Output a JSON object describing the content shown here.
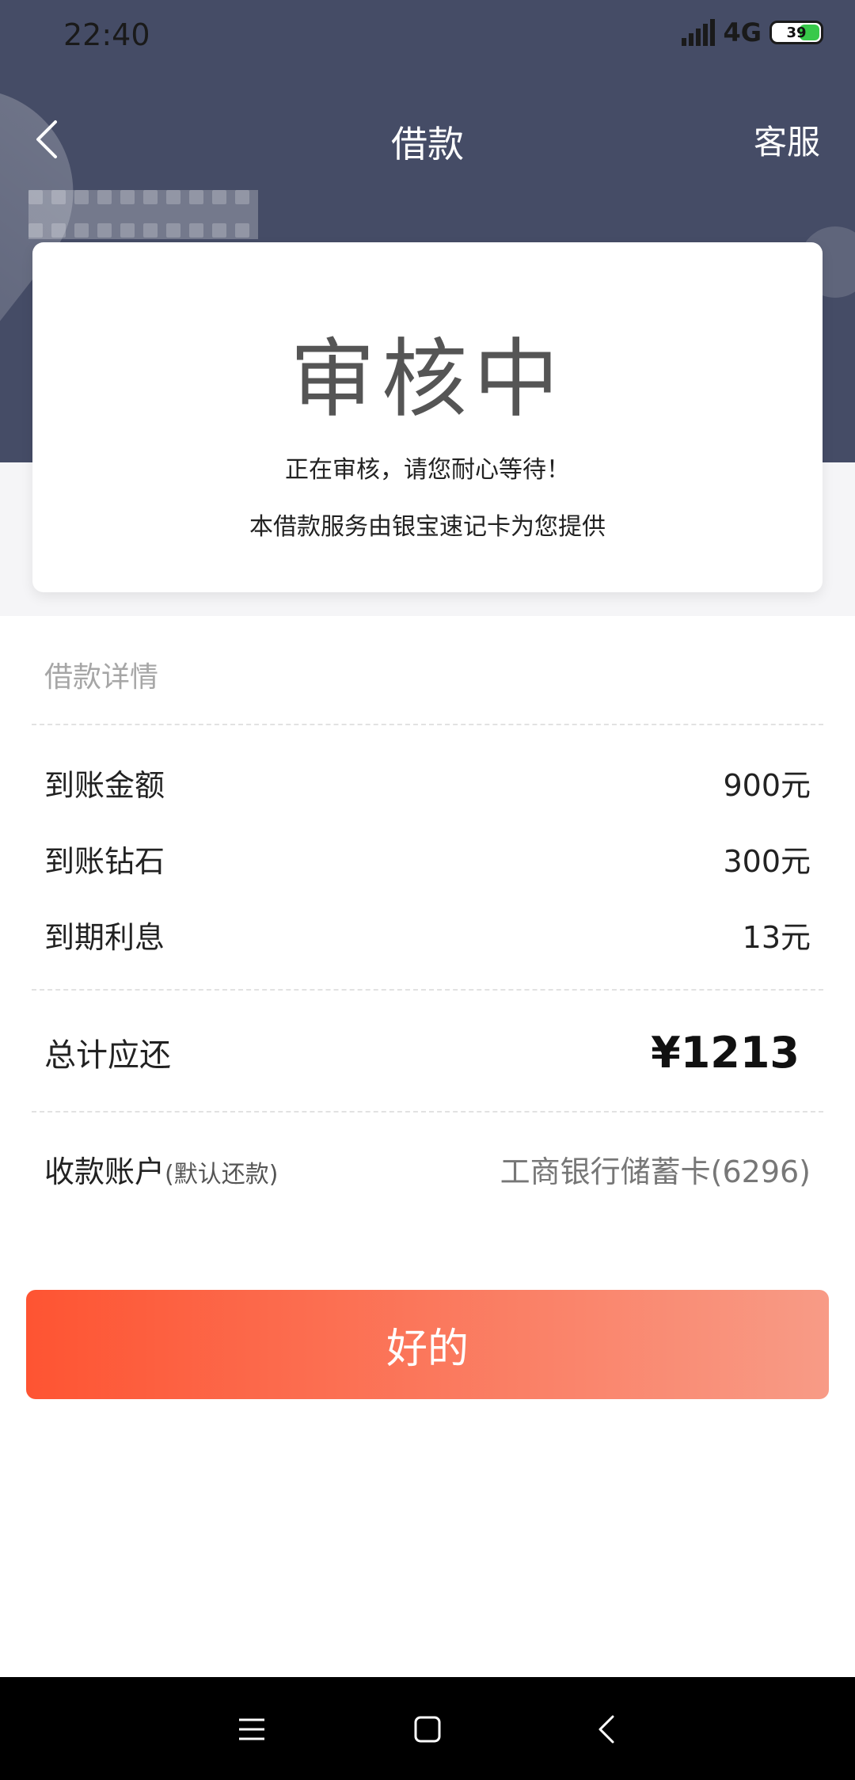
{
  "status_bar": {
    "time": "22:40",
    "network": "4G",
    "battery_level": "39"
  },
  "nav": {
    "title": "借款",
    "service_label": "客服"
  },
  "status_card": {
    "title": "审核中",
    "message": "正在审核，请您耐心等待！",
    "provider": "本借款服务由银宝速记卡为您提供"
  },
  "details": {
    "title": "借款详情",
    "rows": [
      {
        "label": "到账金额",
        "value": "900元"
      },
      {
        "label": "到账钻石",
        "value": "300元"
      },
      {
        "label": "到期利息",
        "value": "13元"
      }
    ],
    "total": {
      "label": "总计应还",
      "value": "¥1213"
    },
    "account": {
      "label": "收款账户",
      "note": "(默认还款)",
      "value": "工商银行储蓄卡(6296)"
    }
  },
  "actions": {
    "ok_label": "好的"
  },
  "icons": {
    "back": "chevron-left-icon",
    "sys_menu": "menu-icon",
    "sys_home": "home-square-icon",
    "sys_back": "back-arrow-icon"
  },
  "colors": {
    "header_bg": "#454c66",
    "button_start": "#fe5432",
    "button_end": "#f89b86"
  }
}
